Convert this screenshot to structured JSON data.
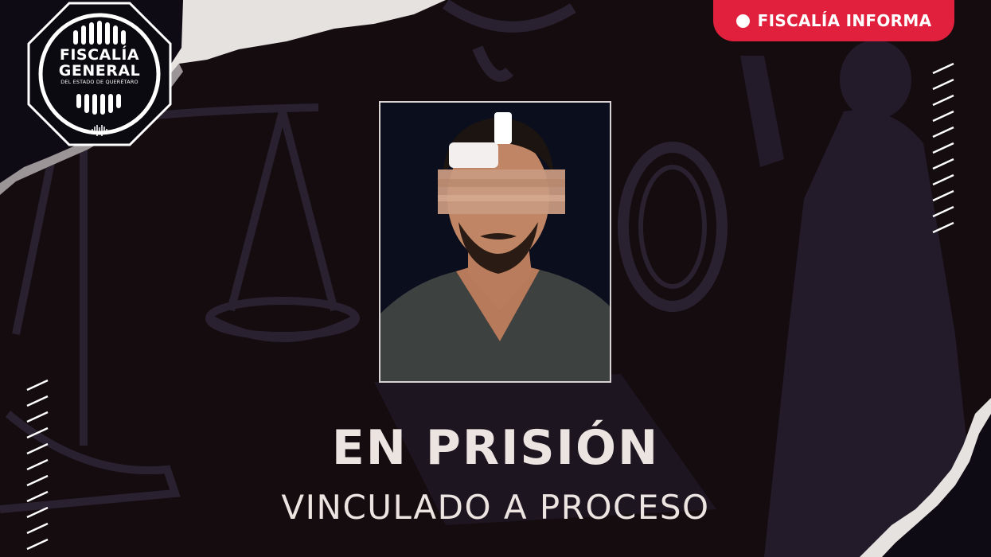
{
  "logo": {
    "line1": "FISCALÍA",
    "line2": "GENERAL",
    "line3": "DEL ESTADO DE QUERÉTARO"
  },
  "badge": {
    "label": "FISCALÍA INFORMA"
  },
  "headline": "EN PRISIÓN",
  "subheadline": "VINCULADO A PROCESO",
  "colors": {
    "background": "#140c0f",
    "accent_red": "#e0203c",
    "text_light": "#ece4e0",
    "torn_paper": "#e6e2df"
  },
  "icons": {
    "badge_dot": "circle-dot-icon",
    "logo_sound": "sound-wave-icon"
  }
}
